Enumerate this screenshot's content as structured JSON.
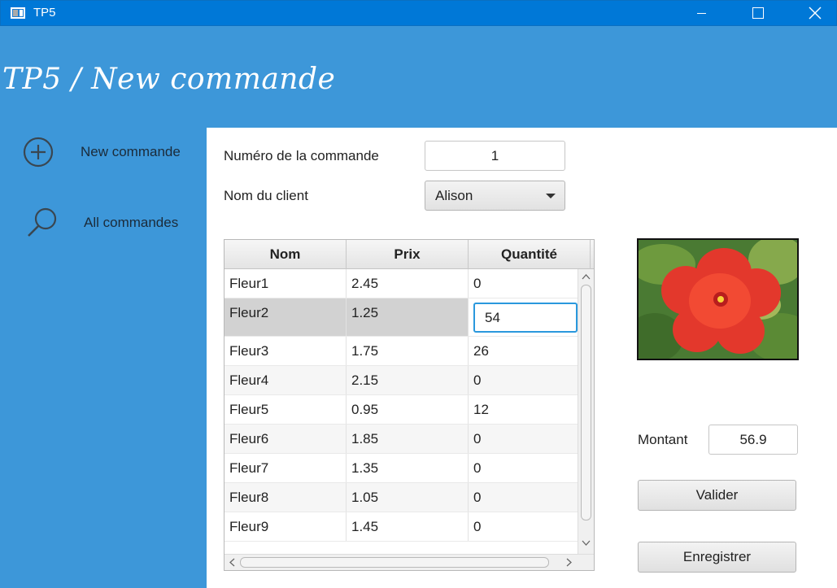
{
  "window": {
    "title": "TP5"
  },
  "header": {
    "title": "TP5 / New commande"
  },
  "sidebar": {
    "items": [
      {
        "label": "New commande",
        "icon": "plus-circle-icon"
      },
      {
        "label": "All commandes",
        "icon": "search-icon"
      }
    ]
  },
  "form": {
    "numero_label": "Numéro de la commande",
    "numero_value": "1",
    "client_label": "Nom du client",
    "client_value": "Alison"
  },
  "table": {
    "columns": [
      "Nom",
      "Prix",
      "Quantité"
    ],
    "rows": [
      {
        "nom": "Fleur1",
        "prix": "2.45",
        "quantite": "0"
      },
      {
        "nom": "Fleur2",
        "prix": "1.25",
        "quantite": "54",
        "editing": true
      },
      {
        "nom": "Fleur3",
        "prix": "1.75",
        "quantite": "26"
      },
      {
        "nom": "Fleur4",
        "prix": "2.15",
        "quantite": "0"
      },
      {
        "nom": "Fleur5",
        "prix": "0.95",
        "quantite": "12"
      },
      {
        "nom": "Fleur6",
        "prix": "1.85",
        "quantite": "0"
      },
      {
        "nom": "Fleur7",
        "prix": "1.35",
        "quantite": "0"
      },
      {
        "nom": "Fleur8",
        "prix": "1.05",
        "quantite": "0"
      },
      {
        "nom": "Fleur9",
        "prix": "1.45",
        "quantite": "0"
      }
    ]
  },
  "montant": {
    "label": "Montant",
    "value": "56.9"
  },
  "buttons": {
    "valider": "Valider",
    "enregistrer": "Enregistrer"
  },
  "colors": {
    "titlebar": "#0078d7",
    "header": "#3d97d9",
    "focus": "#2a98dd"
  }
}
